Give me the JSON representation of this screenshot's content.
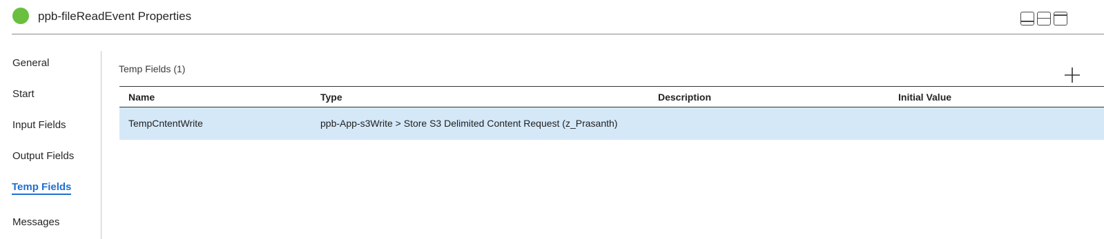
{
  "header": {
    "title": "ppb-fileReadEvent Properties",
    "status_color": "#6bbf3f",
    "layout_buttons": [
      "layout-bottom-panel-icon",
      "layout-split-icon",
      "layout-top-panel-icon"
    ]
  },
  "sidebar": {
    "items": [
      {
        "label": "General"
      },
      {
        "label": "Start"
      },
      {
        "label": "Input Fields"
      },
      {
        "label": "Output Fields"
      },
      {
        "label": "Temp Fields",
        "active": true
      },
      {
        "label": "Messages"
      }
    ]
  },
  "main": {
    "section_title": "Temp Fields (1)",
    "add_icon": "plus-icon",
    "table": {
      "columns": [
        "Name",
        "Type",
        "Description",
        "Initial Value"
      ],
      "rows": [
        {
          "name": "TempCntentWrite",
          "type": "ppb-App-s3Write > Store S3 Delimited Content Request (z_Prasanth)",
          "description": "",
          "initial_value": ""
        }
      ]
    }
  },
  "colors": {
    "accent": "#1f6fd1",
    "selected_row": "#d5e8f8"
  }
}
